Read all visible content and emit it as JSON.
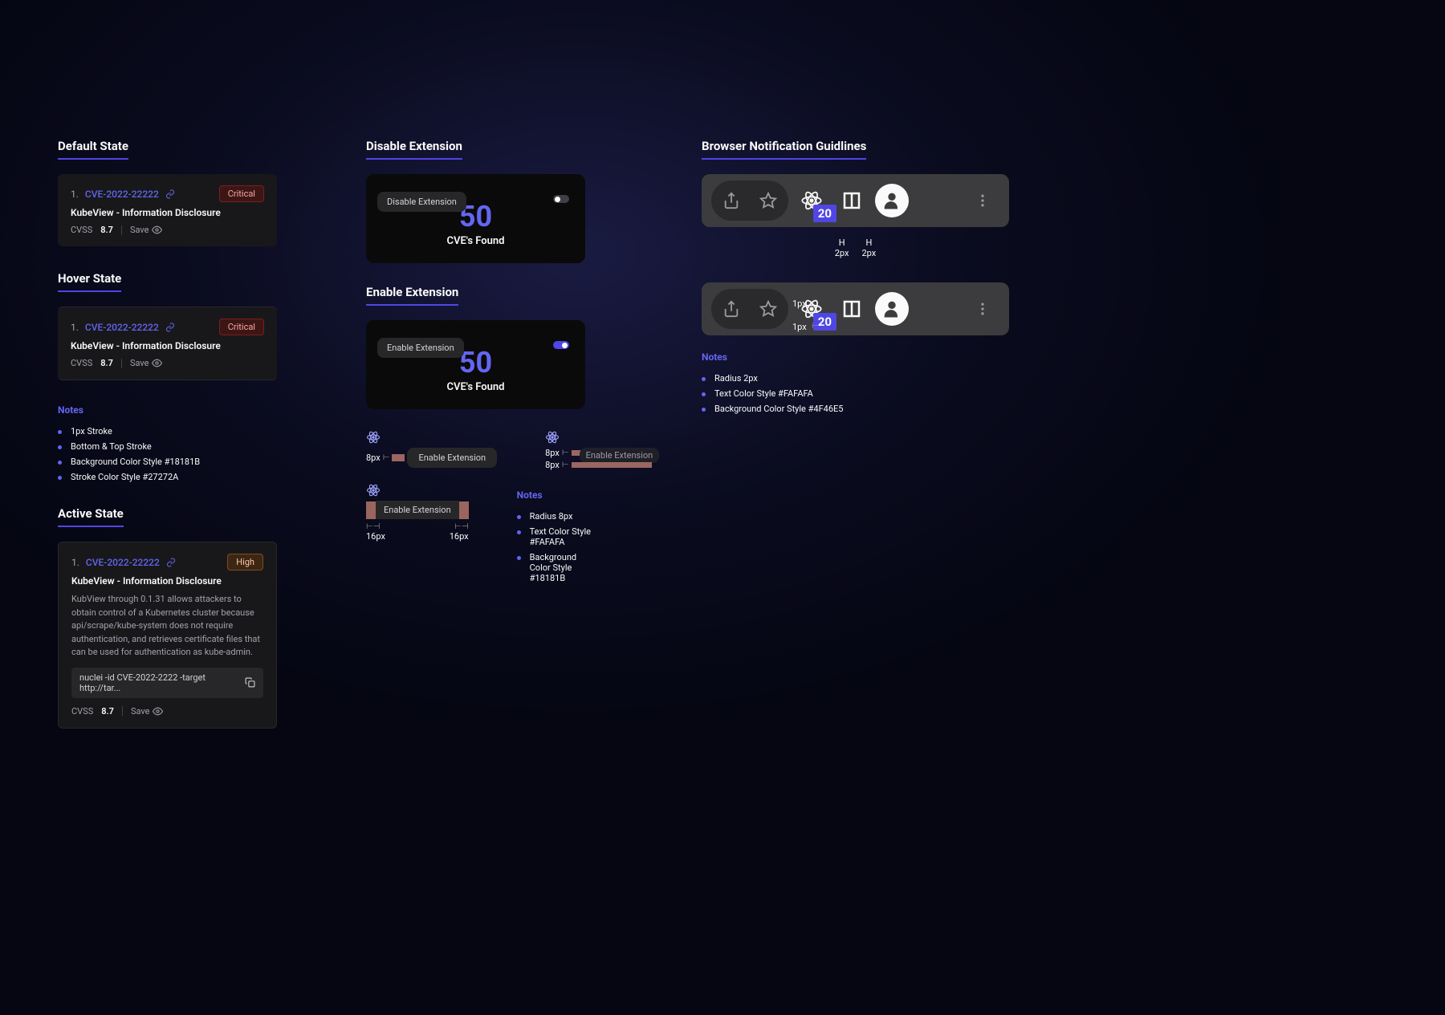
{
  "col1": {
    "default": {
      "heading": "Default State"
    },
    "hover": {
      "heading": "Hover State"
    },
    "active": {
      "heading": "Active State"
    },
    "cve": {
      "index": "1.",
      "id": "CVE-2022-22222",
      "title": "KubeView - Information Disclosure",
      "crit": "Critical",
      "high": "High",
      "desc": "KubView through 0.1.31 allows attackers to obtain control of a Kubernetes cluster because api/scrape/kube-system does not require authentication, and retrieves certificate files that can be used for authentication as kube-admin.",
      "cmd": "nuclei -id CVE-2022-2222 -target http://tar...",
      "cvss_label": "CVSS",
      "cvss_value": "8.7",
      "save": "Save"
    },
    "hover_notes": {
      "title": "Notes",
      "items": [
        "1px Stroke",
        "Bottom & Top Stroke",
        "Background Color Style #18181B",
        "Stroke Color Style #27272A"
      ]
    }
  },
  "col2": {
    "disable": {
      "heading": "Disable Extension",
      "tooltip": "Disable Extension"
    },
    "enable": {
      "heading": "Enable Extension",
      "tooltip": "Enable Extension"
    },
    "popup": {
      "count": "50",
      "found": "CVE's Found"
    },
    "spec_enable": "Enable Extension",
    "spacing": {
      "px8": "8px",
      "px16": "16px"
    },
    "notes": {
      "title": "Notes",
      "items": [
        "Radius 8px",
        "Text Color Style #FAFAFA",
        "Background Color Style #18181B"
      ]
    }
  },
  "col3": {
    "heading": "Browser Notification Guidlines",
    "badge": "20",
    "h_label": "H",
    "px2": "2px",
    "px1": "1px",
    "notes": {
      "title": "Notes",
      "items": [
        "Radius 2px",
        "Text Color Style #FAFAFA",
        "Background Color Style #4F46E5"
      ]
    }
  }
}
